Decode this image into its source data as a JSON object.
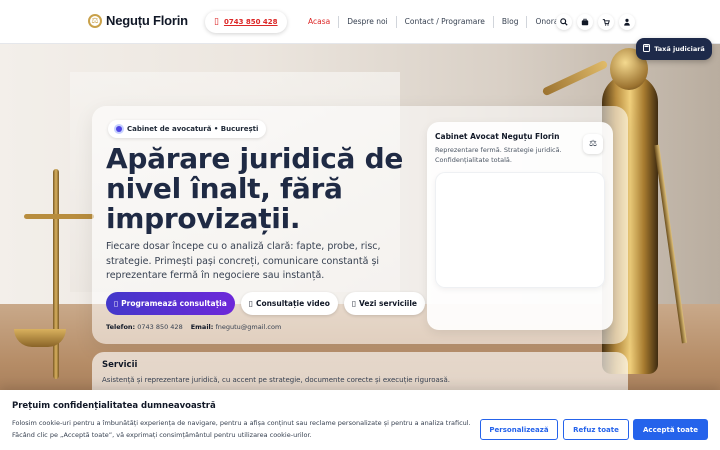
{
  "header": {
    "logo_text": "Neguțu Florin",
    "phone": "0743 850 428",
    "nav": [
      {
        "label": "Acasa",
        "active": true
      },
      {
        "label": "Despre noi",
        "active": false
      },
      {
        "label": "Contact / Programare",
        "active": false
      },
      {
        "label": "Blog",
        "active": false
      },
      {
        "label": "Onorarii",
        "active": false
      }
    ],
    "icons": [
      "search-icon",
      "briefcase-icon",
      "cart-icon",
      "user-icon"
    ]
  },
  "fee_button": {
    "label": "Taxă judiciară",
    "icon": "calculator-icon"
  },
  "hero": {
    "badge": "Cabinet de avocatură • București",
    "title": "Apărare juridică de nivel înalt, fără improvizații.",
    "lead": "Fiecare dosar începe cu o analiză clară: fapte, probe, risc, strategie. Primești pași concreți, comunicare constantă și reprezentare fermă în negociere sau instanță.",
    "buttons": [
      {
        "label": "Programează consultația",
        "style": "primary",
        "icon": "calendar-icon"
      },
      {
        "label": "Consultație video",
        "style": "light",
        "icon": "video-icon"
      },
      {
        "label": "Vezi serviciile",
        "style": "light",
        "icon": "list-icon"
      }
    ],
    "contact": {
      "phone_label": "Telefon:",
      "phone": "0743 850 428",
      "email_label": "Email:",
      "email": "fnegutu@gmail.com"
    },
    "side_card": {
      "title": "Cabinet Avocat Neguțu Florin",
      "desc": "Reprezentare fermă. Strategie juridică. Confidențialitate totală."
    }
  },
  "services": {
    "title": "Servicii",
    "desc": "Asistență și reprezentare juridică, cu accent pe strategie, documente corecte și execuție riguroasă."
  },
  "cookie": {
    "title": "Prețuim confidențialitatea dumneavoastră",
    "text": "Folosim cookie-uri pentru a îmbunătăți experiența de navigare, pentru a afișa conținut sau reclame personalizate și pentru a analiza traficul. Făcând clic pe „Acceptă toate”, vă exprimați consimțământul pentru utilizarea cookie-urilor.",
    "customize": "Personalizează",
    "reject": "Refuz toate",
    "accept": "Acceptă toate"
  },
  "colors": {
    "accent": "#dc2626",
    "primary": "#4338ca",
    "cookie_blue": "#2563eb",
    "navy": "#1e2a4a"
  }
}
